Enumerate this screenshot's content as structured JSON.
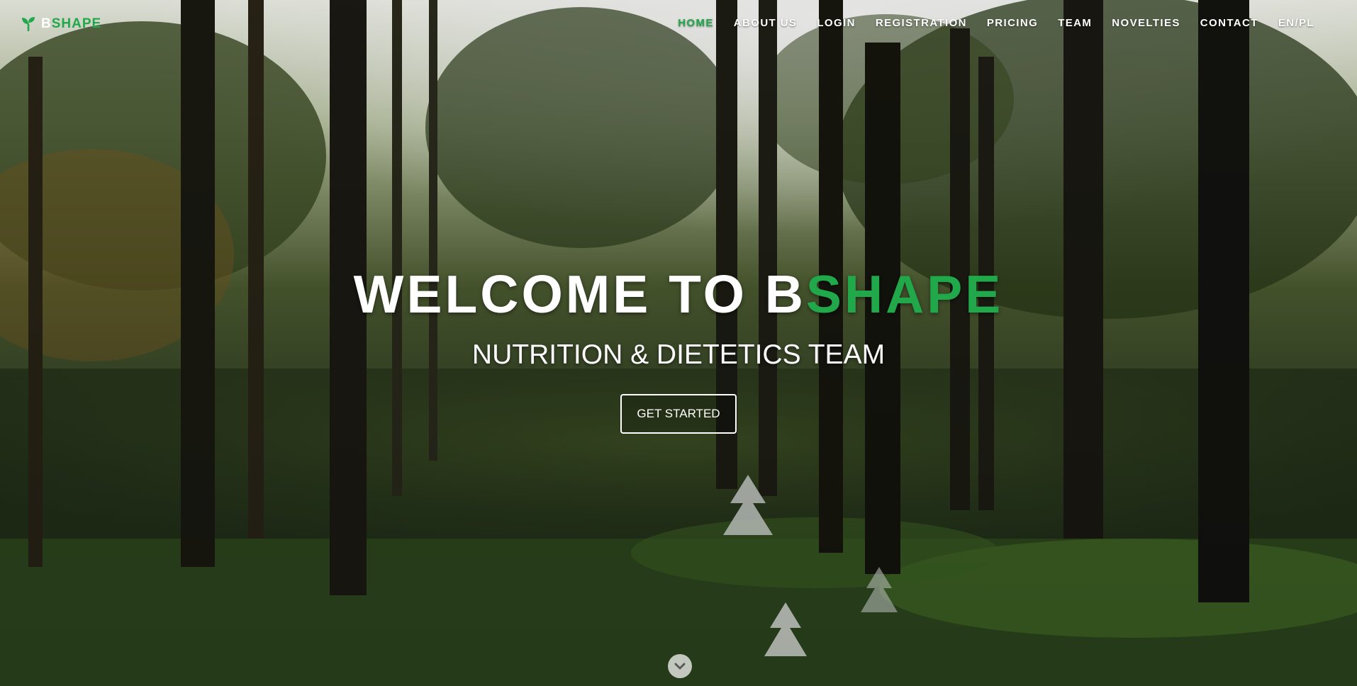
{
  "brand": {
    "prefix": "B",
    "accent": "SHAPE",
    "icon": "sprout-icon",
    "accent_color": "#21a84a"
  },
  "nav": {
    "items": [
      {
        "label": "HOME",
        "active": true
      },
      {
        "label": "ABOUT US",
        "active": false
      },
      {
        "label": "LOGIN",
        "active": false
      },
      {
        "label": "REGISTRATION",
        "active": false
      },
      {
        "label": "PRICING",
        "active": false
      },
      {
        "label": "TEAM",
        "active": false
      },
      {
        "label": "NOVELTIES",
        "active": false
      },
      {
        "label": "CONTACT",
        "active": false
      },
      {
        "label": "EN/PL",
        "active": false
      }
    ]
  },
  "hero": {
    "title_prefix": "WELCOME TO B",
    "title_accent": "SHAPE",
    "subtitle": "NUTRITION & DIETETICS TEAM",
    "cta_label": "GET STARTED",
    "scroll_icon": "chevron-down-icon",
    "background": "forest-photo"
  }
}
